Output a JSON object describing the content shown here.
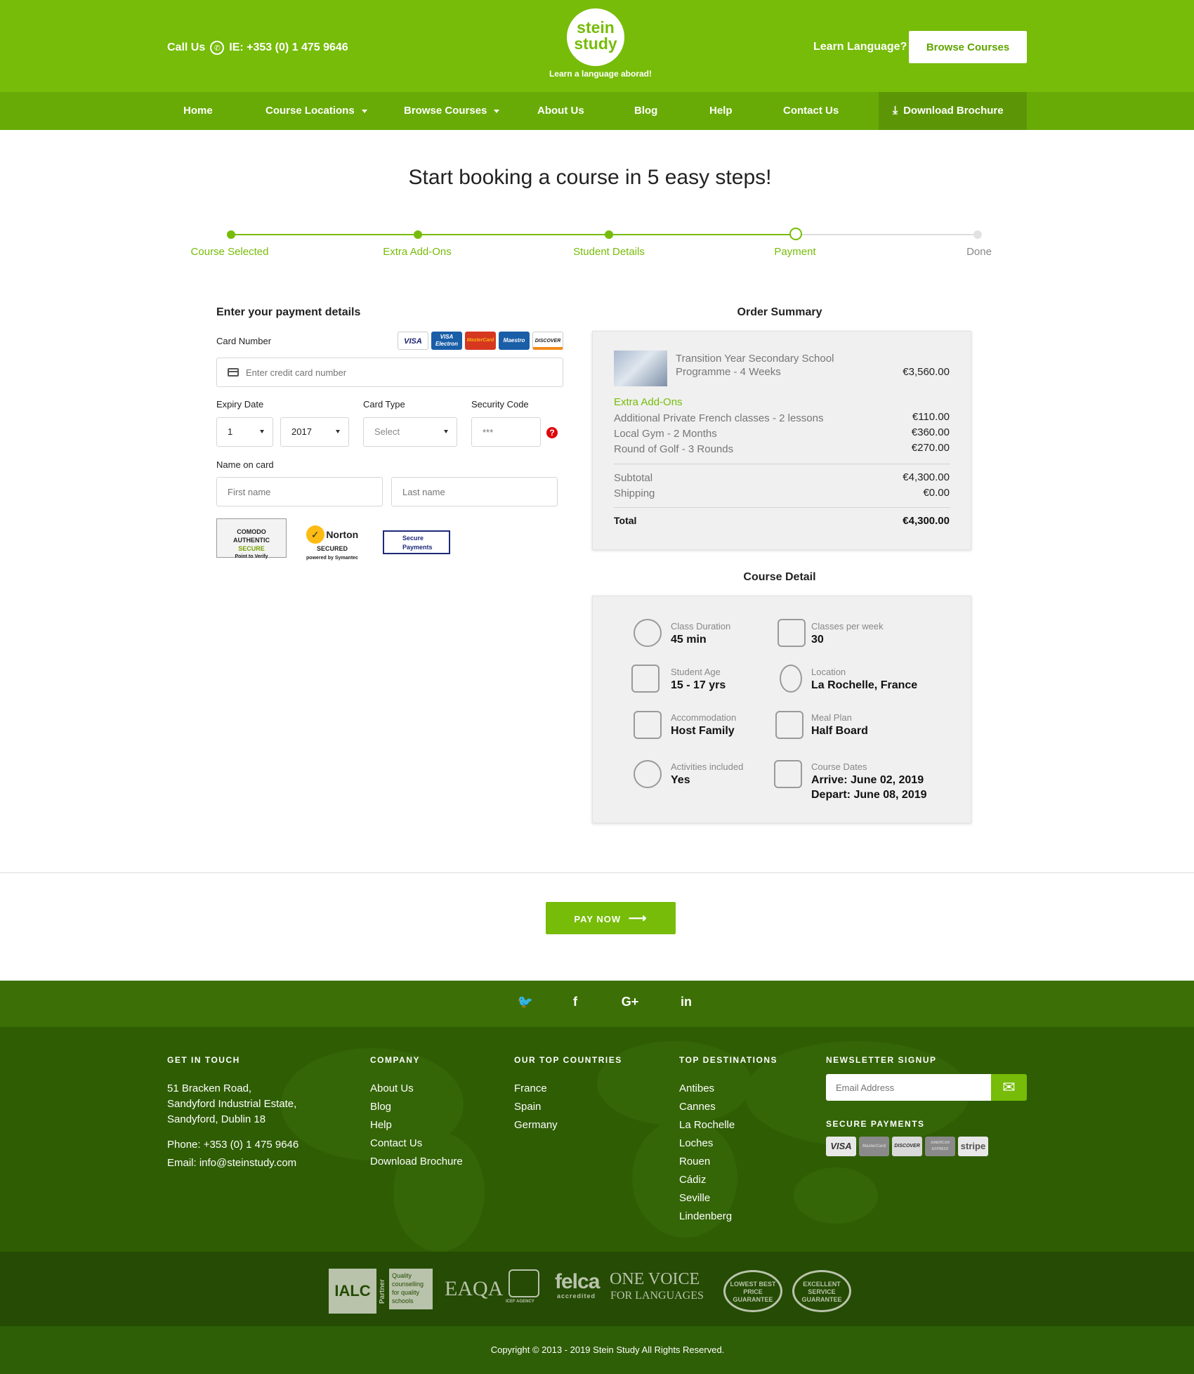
{
  "header": {
    "call_label": "Call Us",
    "phone": "IE: +353 (0) 1 475 9646",
    "logo_line1": "stein",
    "logo_line2": "study",
    "tagline": "Learn a language aborad!",
    "learn_label": "Learn Language?",
    "browse_btn": "Browse Courses"
  },
  "nav": {
    "items": [
      "Home",
      "Course Locations",
      "Browse Courses",
      "About Us",
      "Blog",
      "Help",
      "Contact Us"
    ],
    "download": "Download Brochure"
  },
  "page_title": "Start booking a course in 5 easy steps!",
  "steps": [
    "Course Selected",
    "Extra Add-Ons",
    "Student Details",
    "Payment",
    "Done"
  ],
  "payment": {
    "title": "Enter your payment details",
    "card_number_label": "Card Number",
    "card_logos": [
      "VISA",
      "VISA Electron",
      "MasterCard",
      "Maestro",
      "DISCOVER"
    ],
    "card_placeholder": "Enter credit card number",
    "expiry_label": "Expiry Date",
    "expiry_month": "1",
    "expiry_year": "2017",
    "card_type_label": "Card Type",
    "card_type_value": "Select",
    "security_label": "Security Code",
    "security_placeholder": "***",
    "name_label": "Name on card",
    "first_placeholder": "First name",
    "last_placeholder": "Last name",
    "seals": {
      "comodo_top": "COMODO",
      "comodo_mid": "AUTHENTIC",
      "comodo_bot": "SECURE",
      "comodo_sub": "Point to Verify",
      "norton_name": "Norton",
      "norton_sub": "SECURED",
      "norton_by": "powered by Symantec",
      "secure_line1": "Secure",
      "secure_line2": "Payments"
    }
  },
  "order_summary": {
    "title": "Order Summary",
    "course_name_line1": "Transition Year Secondary School",
    "course_name_line2": "Programme - 4 Weeks",
    "course_price": "€3,560.00",
    "addons_label": "Extra Add-Ons",
    "addons": [
      {
        "name": "Additional Private French classes - 2 lessons",
        "price": "€110.00"
      },
      {
        "name": "Local Gym - 2 Months",
        "price": "€360.00"
      },
      {
        "name": "Round of Golf - 3 Rounds",
        "price": "€270.00"
      }
    ],
    "subtotal_label": "Subtotal",
    "subtotal": "€4,300.00",
    "shipping_label": "Shipping",
    "shipping": "€0.00",
    "total_label": "Total",
    "total": "€4,300.00"
  },
  "course_detail": {
    "title": "Course Detail",
    "items": [
      {
        "label": "Class Duration",
        "value": "45 min",
        "icon": "clock-icon"
      },
      {
        "label": "Classes per week",
        "value": "30",
        "icon": "book-icon"
      },
      {
        "label": "Student Age",
        "value": "15 - 17 yrs",
        "icon": "graduation-cap-icon"
      },
      {
        "label": "Location",
        "value": "La Rochelle, France",
        "icon": "map-pin-icon"
      },
      {
        "label": "Accommodation",
        "value": "Host Family",
        "icon": "bed-icon"
      },
      {
        "label": "Meal Plan",
        "value": "Half Board",
        "icon": "meal-icon"
      },
      {
        "label": "Activities included",
        "value": "Yes",
        "icon": "activities-icon"
      },
      {
        "label": "Course Dates",
        "value": "Arrive: June 02, 2019",
        "value2": "Depart: June 08, 2019",
        "icon": "calendar-icon"
      }
    ]
  },
  "pay_now": "PAY NOW",
  "footer": {
    "get_in_touch": "GET IN TOUCH",
    "address": [
      "51 Bracken Road,",
      "Sandyford Industrial Estate,",
      "Sandyford, Dublin 18"
    ],
    "phone": "Phone: +353 (0) 1 475 9646",
    "email": "Email: info@steinstudy.com",
    "company_head": "COMPANY",
    "company_links": [
      "About Us",
      "Blog",
      "Help",
      "Contact Us",
      "Download Brochure"
    ],
    "countries_head": "OUR TOP COUNTRIES",
    "countries": [
      "France",
      "Spain",
      "Germany"
    ],
    "destinations_head": "TOP DESTINATIONS",
    "destinations": [
      "Antibes",
      "Cannes",
      "La Rochelle",
      "Loches",
      "Rouen",
      "Cádiz",
      "Seville",
      "Lindenberg"
    ],
    "newsletter_head": "NEWSLETTER SIGNUP",
    "email_placeholder": "Email Address",
    "secure_head": "SECURE PAYMENTS",
    "payment_logos": [
      "VISA",
      "MasterCard",
      "DISCOVER",
      "AMERICAN EXPRESS",
      "stripe"
    ],
    "social": [
      "twitter-icon",
      "facebook-icon",
      "google-plus-icon",
      "linkedin-icon"
    ],
    "badges": {
      "ialc": "IALC",
      "ialc_partner": "Partner",
      "ialc_text": "Quality counselling for quality schools",
      "eaqa": "EAQA",
      "icef": "ICEF AGENCY",
      "felca": "felca",
      "felca_sub": "accredited",
      "onevoice1": "ONE VOICE",
      "onevoice2": "FOR LANGUAGES",
      "lowest": "LOWEST BEST PRICE GUARANTEE",
      "excellent": "EXCELLENT SERVICE GUARANTEE"
    },
    "copyright": "Copyright © 2013 - 2019 Stein Study All Rights Reserved."
  }
}
